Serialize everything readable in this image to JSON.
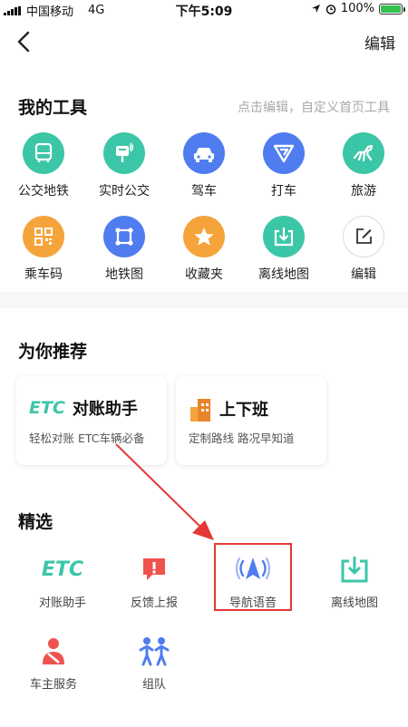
{
  "status_bar": {
    "carrier": "中国移动",
    "network": "4G",
    "time": "下午5:09",
    "battery": "100%"
  },
  "nav": {
    "edit_label": "编辑"
  },
  "my_tools": {
    "title": "我的工具",
    "hint": "点击编辑，自定义首页工具",
    "items": [
      {
        "label": "公交地铁",
        "icon": "bus-icon",
        "color": "#3cc6a8"
      },
      {
        "label": "实时公交",
        "icon": "bus-stop-icon",
        "color": "#3cc6a8"
      },
      {
        "label": "驾车",
        "icon": "car-icon",
        "color": "#4f7df0"
      },
      {
        "label": "打车",
        "icon": "taxi-icon",
        "color": "#4f7df0"
      },
      {
        "label": "旅游",
        "icon": "horse-icon",
        "color": "#3cc6a8"
      },
      {
        "label": "乘车码",
        "icon": "qr-code-icon",
        "color": "#f5a43b"
      },
      {
        "label": "地铁图",
        "icon": "subway-map-icon",
        "color": "#4f7df0"
      },
      {
        "label": "收藏夹",
        "icon": "star-icon",
        "color": "#f5a43b"
      },
      {
        "label": "离线地图",
        "icon": "offline-map-icon",
        "color": "#3cc6a8"
      },
      {
        "label": "编辑",
        "icon": "edit-icon",
        "color": "#ffffff"
      }
    ]
  },
  "recommend": {
    "title": "为你推荐",
    "cards": [
      {
        "logo": "ETC",
        "title": "对账助手",
        "subtitle": "轻松对账 ETC车辆必备"
      },
      {
        "title": "上下班",
        "subtitle": "定制路线 路况早知道"
      }
    ]
  },
  "featured": {
    "title": "精选",
    "items": [
      {
        "label": "对账助手",
        "logo": "ETC"
      },
      {
        "label": "反馈上报"
      },
      {
        "label": "导航语音"
      },
      {
        "label": "离线地图"
      },
      {
        "label": "车主服务"
      },
      {
        "label": "组队"
      }
    ]
  },
  "colors": {
    "teal": "#3cc6a8",
    "blue": "#4f7df0",
    "orange": "#f5a43b",
    "red": "#e53935"
  }
}
